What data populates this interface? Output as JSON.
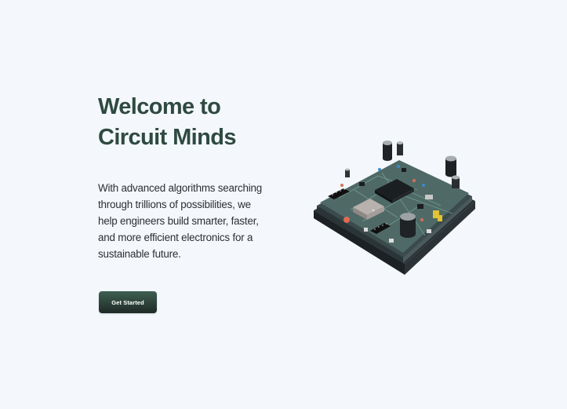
{
  "hero": {
    "headline_lines": [
      "Welcome to",
      "Circuit Minds"
    ],
    "body_lines": [
      "With advanced algorithms searching",
      "through trillions of possibilities, we",
      "help engineers build smarter, faster,",
      "and more efficient electronics for a",
      "sustainable future."
    ],
    "cta_label": "Get Started"
  },
  "colors": {
    "background": "#f4f8fd",
    "headline": "#2f4a40",
    "body_text": "#2b2f33",
    "button_top": "#3f5f52",
    "button_bottom": "#1f2a26"
  },
  "media": {
    "illustration": "circuit-board-icon"
  }
}
